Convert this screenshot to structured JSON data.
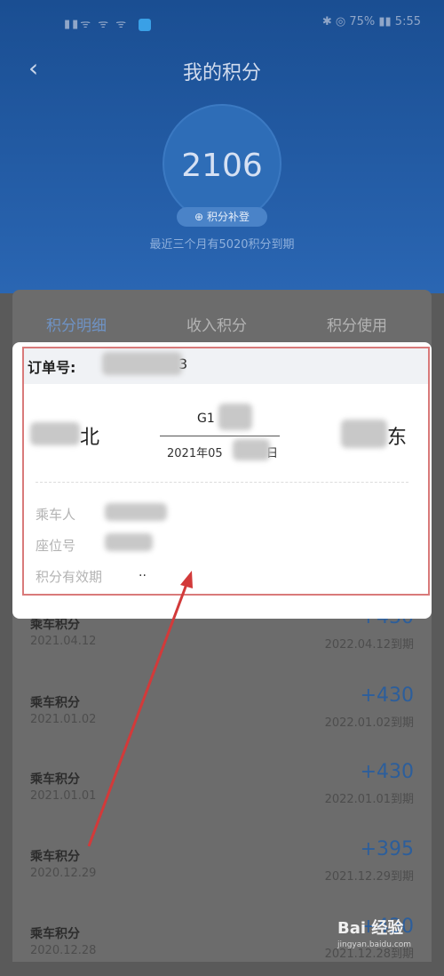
{
  "status_bar": {
    "left_text": "▮▮ᯤ ᯤ ᯤ",
    "right_text": "✱ ◎ 75% ▮▮ 5:55"
  },
  "header": {
    "back_glyph": "‹",
    "title": "我的积分"
  },
  "points": {
    "value": "2106",
    "redeem_label": "积分补登",
    "expire_note": "最近三个月有5020积分到期"
  },
  "tabs": [
    {
      "label": "积分明细",
      "active": true
    },
    {
      "label": "收入积分",
      "active": false
    },
    {
      "label": "积分使用",
      "active": false
    }
  ],
  "records": [
    {
      "title": "乘车积分",
      "date": "2021.04.12",
      "points": "+430",
      "expire": "2022.04.12到期"
    },
    {
      "title": "乘车积分",
      "date": "2021.01.02",
      "points": "+430",
      "expire": "2022.01.02到期"
    },
    {
      "title": "乘车积分",
      "date": "2021.01.01",
      "points": "+430",
      "expire": "2022.01.01到期"
    },
    {
      "title": "乘车积分",
      "date": "2020.12.29",
      "points": "+395",
      "expire": "2021.12.29到期"
    },
    {
      "title": "乘车积分",
      "date": "2020.12.28",
      "points": "+430",
      "expire": "2021.12.28到期"
    }
  ],
  "modal": {
    "order_label": "订单号: ",
    "order_tail": "3",
    "from_station": "北",
    "to_station": "东",
    "train_no": "G1",
    "trip_date": "2021年05",
    "trip_date_tail": "日",
    "passenger_label": "乘车人",
    "seat_label": "座位号",
    "validity_label": "积分有效期",
    "validity_value": ".."
  },
  "watermark": {
    "logo": "Bai 经验",
    "sub": "jingyan.baidu.com"
  },
  "colors": {
    "header_blue": "#1a4e92",
    "active_tab": "#6f93c5",
    "points_blue": "#2c5e9b",
    "annotation_red": "#d23a3a"
  }
}
